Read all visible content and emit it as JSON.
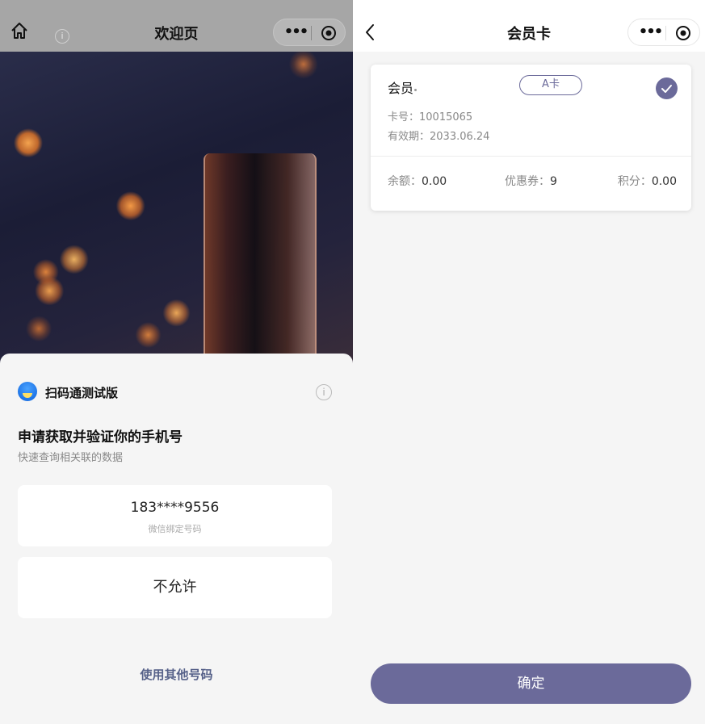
{
  "left": {
    "nav": {
      "title": "欢迎页",
      "home_icon": "home-icon",
      "info_icon": "info-icon"
    },
    "sheet": {
      "app_name": "扫码通测试版",
      "request_title": "申请获取并验证你的手机号",
      "request_subtitle": "快速查询相关联的数据",
      "phone_number": "183****9556",
      "phone_caption": "微信绑定号码",
      "deny_label": "不允许",
      "other_number_label": "使用其他号码"
    }
  },
  "right": {
    "nav": {
      "title": "会员卡",
      "back_icon": "chevron-left-icon"
    },
    "card": {
      "name": "会员",
      "tag": "A卡",
      "card_no_label": "卡号：",
      "card_no": "10015065",
      "expiry_label": "有效期：",
      "expiry": "2033.06.24",
      "balance_label": "余额：",
      "balance": "0.00",
      "coupon_label": "优惠券：",
      "coupon": "9",
      "points_label": "积分：",
      "points": "0.00",
      "selected": true
    },
    "confirm_label": "确定"
  },
  "capsule": {
    "more_icon": "more-dots-icon",
    "target_icon": "target-icon"
  },
  "colors": {
    "accent": "#6b6a9a",
    "link": "#566189",
    "sheet_bg": "#f5f5f5"
  }
}
